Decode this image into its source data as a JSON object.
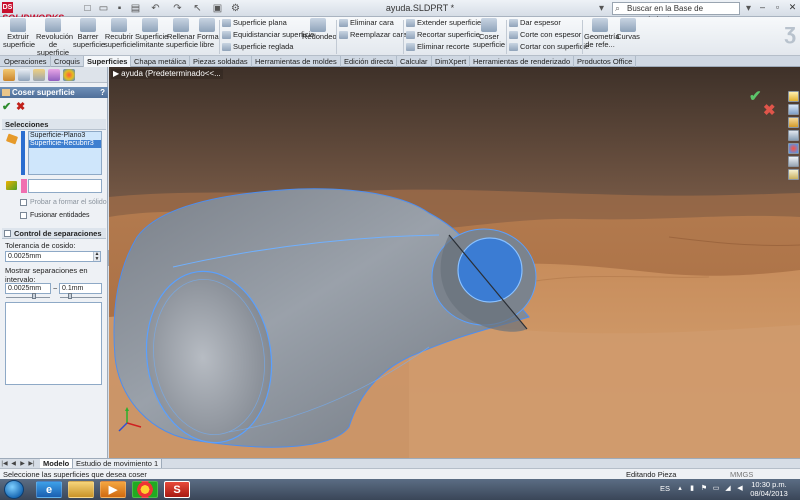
{
  "app": {
    "logo_text": "SOLIDWORKS",
    "logo_badge": "DS",
    "document_title": "ayuda.SLDPRT *",
    "search_placeholder": "Buscar en la Base de conocimiento"
  },
  "ribbon": {
    "big_buttons": [
      {
        "label": "Extruir superficie"
      },
      {
        "label": "Revolución de superficie"
      },
      {
        "label": "Barrer superficie"
      },
      {
        "label": "Recubrir superficie"
      },
      {
        "label": "Superficie limitante"
      },
      {
        "label": "Rellenar superficie"
      },
      {
        "label": "Forma libre"
      }
    ],
    "small_group1": [
      "Superficie plana",
      "Equidistanciar superficie",
      "Superficie reglada"
    ],
    "redondeo": "Redondeo",
    "small_group2": [
      "Eliminar cara",
      "Reemplazar cara"
    ],
    "small_group3": [
      "Extender superficie",
      "Recortar superficie",
      "Eliminar recorte"
    ],
    "coser": "Coser superficie",
    "small_group4": [
      "Dar espesor",
      "Corte con espesor",
      "Cortar con superficie"
    ],
    "geometria": "Geometría de refe...",
    "curvas": "Curvas"
  },
  "command_tabs": [
    {
      "label": "Operaciones",
      "active": false
    },
    {
      "label": "Croquis",
      "active": false
    },
    {
      "label": "Superficies",
      "active": true
    },
    {
      "label": "Chapa metálica",
      "active": false
    },
    {
      "label": "Piezas soldadas",
      "active": false
    },
    {
      "label": "Herramientas de moldes",
      "active": false
    },
    {
      "label": "Edición directa",
      "active": false
    },
    {
      "label": "Calcular",
      "active": false
    },
    {
      "label": "DimXpert",
      "active": false
    },
    {
      "label": "Herramientas de renderizado",
      "active": false
    },
    {
      "label": "Productos Office",
      "active": false
    }
  ],
  "property_manager": {
    "title": "Coser superficie",
    "help": "?",
    "ok_glyph": "✔",
    "cancel_glyph": "✖",
    "selections": {
      "title": "Selecciones",
      "items": [
        {
          "label": "Superficie-Plano3",
          "selected": false
        },
        {
          "label": "Superficie-Recubrir3",
          "selected": true
        }
      ],
      "try_solid": "Probar a formar el sólido",
      "merge": "Fusionar entidades"
    },
    "gap_control": {
      "title": "Control de separaciones",
      "tolerance_label": "Tolerancia de cosido:",
      "tolerance_value": "0.0025mm",
      "range_label": "Mostrar separaciones en intervalo:",
      "range_min": "0.0025mm",
      "range_sep": "~",
      "range_max": "0.1mm"
    }
  },
  "viewport": {
    "breadcrumb": "ayuda  (Predeterminado<<...",
    "ok_glyph": "✔",
    "cancel_glyph": "✖"
  },
  "bottom_tabs": [
    {
      "label": "Modelo",
      "active": true
    },
    {
      "label": "Estudio de movimiento 1",
      "active": false
    }
  ],
  "status": {
    "message": "Seleccione las superficies que desea coser",
    "mode": "Editando Pieza",
    "units": "MMGS"
  },
  "taskbar": {
    "language": "ES",
    "time": "10:30 p.m.",
    "date": "08/04/2013"
  },
  "colors": {
    "accent": "#3e7fd0",
    "model_gray": "#8c929b",
    "edge_blue": "#5aa0ff",
    "brand_red": "#c8102e"
  }
}
